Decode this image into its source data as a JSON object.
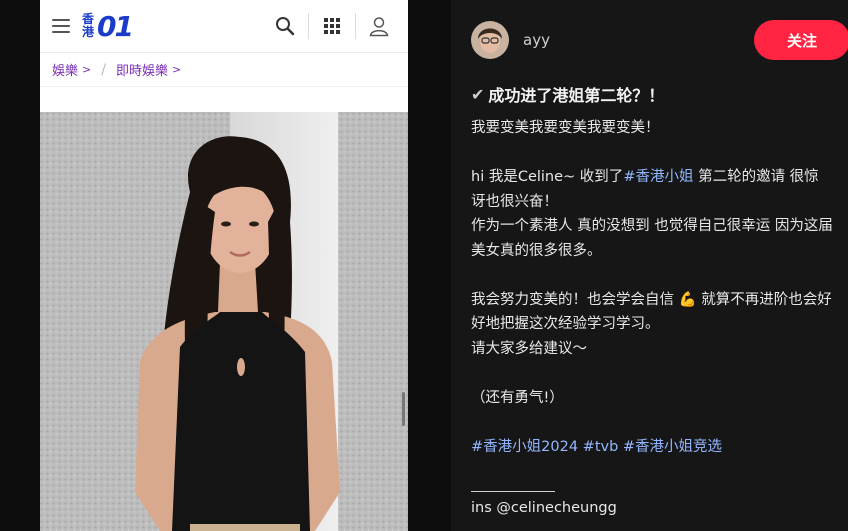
{
  "site": {
    "logo_chars": [
      "香",
      "港"
    ],
    "logo_mark": "01",
    "brand_color": "#1a3cc8",
    "icons": [
      "menu-icon",
      "search-icon",
      "grid-icon",
      "user-icon"
    ]
  },
  "breadcrumb": {
    "items": [
      {
        "label": "娛樂"
      },
      {
        "label": "即時娛樂"
      }
    ],
    "separator": "/",
    "color": "#7a2fb5"
  },
  "post": {
    "author": "ayy",
    "follow_label": "关注",
    "follow_color": "#ff2442",
    "title": "成功进了港姐第二轮？！",
    "line1": "我要变美我要变美我要变美！",
    "line2_a": "hi 我是Celine~ 收到了",
    "line2_tag": "#香港小姐",
    "line2_b": " 第二轮的邀请 很惊讶也很兴奋！",
    "line3": "作为一个素港人 真的没想到 也觉得自己很幸运 因为这届美女真的很多很多。",
    "line4_a": "我会努力变美的！也会学会自信 ",
    "line4_emoji": "💪",
    "line4_b": " 就算不再进阶也会好好地把握这次经验学习学习。",
    "line5": "请大家多给建议～",
    "line6": "（还有勇气!）",
    "tags": [
      "#香港小姐2024",
      "#tvb",
      "#香港小姐竞选"
    ],
    "ins": "ins @celinecheungg",
    "tag_color": "#93b7ff"
  }
}
